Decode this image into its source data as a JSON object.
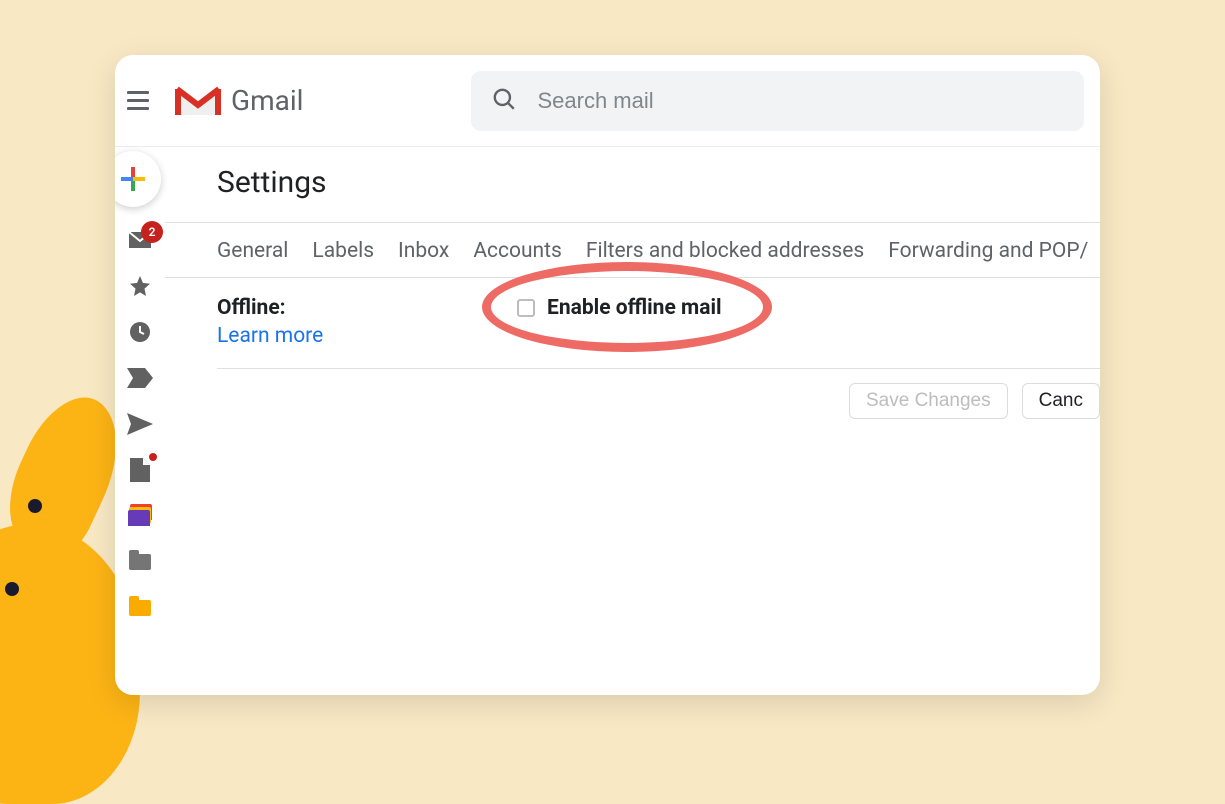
{
  "header": {
    "app_name": "Gmail",
    "search_placeholder": "Search mail"
  },
  "left_rail": {
    "compose_label": "Compose",
    "inbox_badge": "2"
  },
  "main": {
    "page_title": "Settings",
    "tabs": [
      "General",
      "Labels",
      "Inbox",
      "Accounts",
      "Filters and blocked addresses",
      "Forwarding and POP/"
    ],
    "offline": {
      "section_label": "Offline:",
      "learn_more": "Learn more",
      "checkbox_label": "Enable offline mail"
    },
    "buttons": {
      "save": "Save Changes",
      "cancel": "Canc"
    }
  }
}
